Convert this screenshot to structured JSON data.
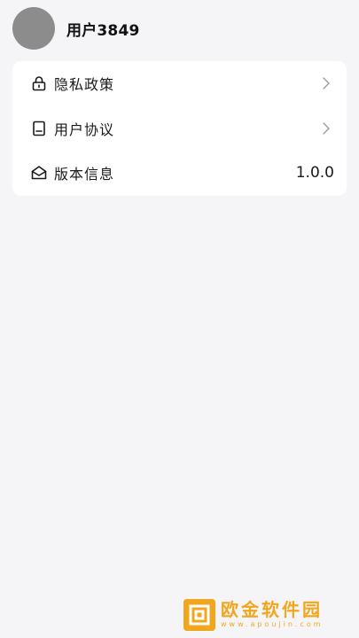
{
  "profile": {
    "username": "用户3849"
  },
  "menu": {
    "items": [
      {
        "label": "隐私政策",
        "icon": "lock-icon"
      },
      {
        "label": "用户协议",
        "icon": "document-icon"
      },
      {
        "label": "版本信息",
        "icon": "mail-open-icon",
        "value": "1.0.0"
      }
    ]
  },
  "watermark": {
    "title": "欧金软件园",
    "url": "www.apoujin.com"
  },
  "colors": {
    "background": "#f5f5f7",
    "card": "#ffffff",
    "avatar": "#8c8c8c",
    "watermark": "#f1a71d"
  }
}
